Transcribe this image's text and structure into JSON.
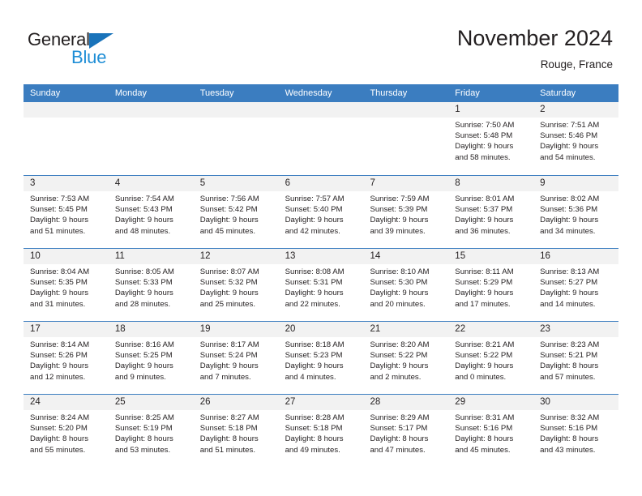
{
  "brand": {
    "name_part1": "General",
    "name_part2": "Blue",
    "color_dark": "#231f20",
    "color_blue": "#1f8ed6",
    "triangle_color": "#1973ba"
  },
  "header": {
    "title": "November 2024",
    "subtitle": "Rouge, France"
  },
  "theme": {
    "header_bg": "#3b7dc0",
    "header_text": "#ffffff",
    "day_number_bg": "#f2f2f2",
    "cell_bg": "#ffffff",
    "text": "#231f20"
  },
  "weekdays": [
    "Sunday",
    "Monday",
    "Tuesday",
    "Wednesday",
    "Thursday",
    "Friday",
    "Saturday"
  ],
  "weeks": [
    [
      {
        "day": "",
        "lines": []
      },
      {
        "day": "",
        "lines": []
      },
      {
        "day": "",
        "lines": []
      },
      {
        "day": "",
        "lines": []
      },
      {
        "day": "",
        "lines": []
      },
      {
        "day": "1",
        "lines": [
          "Sunrise: 7:50 AM",
          "Sunset: 5:48 PM",
          "Daylight: 9 hours",
          "and 58 minutes."
        ]
      },
      {
        "day": "2",
        "lines": [
          "Sunrise: 7:51 AM",
          "Sunset: 5:46 PM",
          "Daylight: 9 hours",
          "and 54 minutes."
        ]
      }
    ],
    [
      {
        "day": "3",
        "lines": [
          "Sunrise: 7:53 AM",
          "Sunset: 5:45 PM",
          "Daylight: 9 hours",
          "and 51 minutes."
        ]
      },
      {
        "day": "4",
        "lines": [
          "Sunrise: 7:54 AM",
          "Sunset: 5:43 PM",
          "Daylight: 9 hours",
          "and 48 minutes."
        ]
      },
      {
        "day": "5",
        "lines": [
          "Sunrise: 7:56 AM",
          "Sunset: 5:42 PM",
          "Daylight: 9 hours",
          "and 45 minutes."
        ]
      },
      {
        "day": "6",
        "lines": [
          "Sunrise: 7:57 AM",
          "Sunset: 5:40 PM",
          "Daylight: 9 hours",
          "and 42 minutes."
        ]
      },
      {
        "day": "7",
        "lines": [
          "Sunrise: 7:59 AM",
          "Sunset: 5:39 PM",
          "Daylight: 9 hours",
          "and 39 minutes."
        ]
      },
      {
        "day": "8",
        "lines": [
          "Sunrise: 8:01 AM",
          "Sunset: 5:37 PM",
          "Daylight: 9 hours",
          "and 36 minutes."
        ]
      },
      {
        "day": "9",
        "lines": [
          "Sunrise: 8:02 AM",
          "Sunset: 5:36 PM",
          "Daylight: 9 hours",
          "and 34 minutes."
        ]
      }
    ],
    [
      {
        "day": "10",
        "lines": [
          "Sunrise: 8:04 AM",
          "Sunset: 5:35 PM",
          "Daylight: 9 hours",
          "and 31 minutes."
        ]
      },
      {
        "day": "11",
        "lines": [
          "Sunrise: 8:05 AM",
          "Sunset: 5:33 PM",
          "Daylight: 9 hours",
          "and 28 minutes."
        ]
      },
      {
        "day": "12",
        "lines": [
          "Sunrise: 8:07 AM",
          "Sunset: 5:32 PM",
          "Daylight: 9 hours",
          "and 25 minutes."
        ]
      },
      {
        "day": "13",
        "lines": [
          "Sunrise: 8:08 AM",
          "Sunset: 5:31 PM",
          "Daylight: 9 hours",
          "and 22 minutes."
        ]
      },
      {
        "day": "14",
        "lines": [
          "Sunrise: 8:10 AM",
          "Sunset: 5:30 PM",
          "Daylight: 9 hours",
          "and 20 minutes."
        ]
      },
      {
        "day": "15",
        "lines": [
          "Sunrise: 8:11 AM",
          "Sunset: 5:29 PM",
          "Daylight: 9 hours",
          "and 17 minutes."
        ]
      },
      {
        "day": "16",
        "lines": [
          "Sunrise: 8:13 AM",
          "Sunset: 5:27 PM",
          "Daylight: 9 hours",
          "and 14 minutes."
        ]
      }
    ],
    [
      {
        "day": "17",
        "lines": [
          "Sunrise: 8:14 AM",
          "Sunset: 5:26 PM",
          "Daylight: 9 hours",
          "and 12 minutes."
        ]
      },
      {
        "day": "18",
        "lines": [
          "Sunrise: 8:16 AM",
          "Sunset: 5:25 PM",
          "Daylight: 9 hours",
          "and 9 minutes."
        ]
      },
      {
        "day": "19",
        "lines": [
          "Sunrise: 8:17 AM",
          "Sunset: 5:24 PM",
          "Daylight: 9 hours",
          "and 7 minutes."
        ]
      },
      {
        "day": "20",
        "lines": [
          "Sunrise: 8:18 AM",
          "Sunset: 5:23 PM",
          "Daylight: 9 hours",
          "and 4 minutes."
        ]
      },
      {
        "day": "21",
        "lines": [
          "Sunrise: 8:20 AM",
          "Sunset: 5:22 PM",
          "Daylight: 9 hours",
          "and 2 minutes."
        ]
      },
      {
        "day": "22",
        "lines": [
          "Sunrise: 8:21 AM",
          "Sunset: 5:22 PM",
          "Daylight: 9 hours",
          "and 0 minutes."
        ]
      },
      {
        "day": "23",
        "lines": [
          "Sunrise: 8:23 AM",
          "Sunset: 5:21 PM",
          "Daylight: 8 hours",
          "and 57 minutes."
        ]
      }
    ],
    [
      {
        "day": "24",
        "lines": [
          "Sunrise: 8:24 AM",
          "Sunset: 5:20 PM",
          "Daylight: 8 hours",
          "and 55 minutes."
        ]
      },
      {
        "day": "25",
        "lines": [
          "Sunrise: 8:25 AM",
          "Sunset: 5:19 PM",
          "Daylight: 8 hours",
          "and 53 minutes."
        ]
      },
      {
        "day": "26",
        "lines": [
          "Sunrise: 8:27 AM",
          "Sunset: 5:18 PM",
          "Daylight: 8 hours",
          "and 51 minutes."
        ]
      },
      {
        "day": "27",
        "lines": [
          "Sunrise: 8:28 AM",
          "Sunset: 5:18 PM",
          "Daylight: 8 hours",
          "and 49 minutes."
        ]
      },
      {
        "day": "28",
        "lines": [
          "Sunrise: 8:29 AM",
          "Sunset: 5:17 PM",
          "Daylight: 8 hours",
          "and 47 minutes."
        ]
      },
      {
        "day": "29",
        "lines": [
          "Sunrise: 8:31 AM",
          "Sunset: 5:16 PM",
          "Daylight: 8 hours",
          "and 45 minutes."
        ]
      },
      {
        "day": "30",
        "lines": [
          "Sunrise: 8:32 AM",
          "Sunset: 5:16 PM",
          "Daylight: 8 hours",
          "and 43 minutes."
        ]
      }
    ]
  ]
}
